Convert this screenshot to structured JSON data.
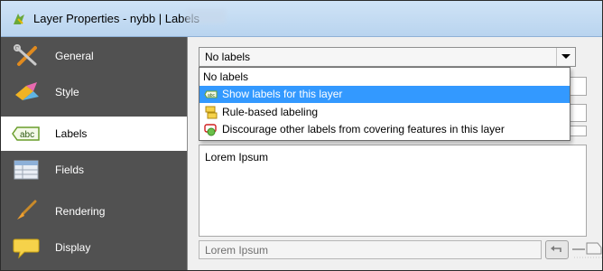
{
  "window": {
    "title": "Layer Properties - nybb | Labels"
  },
  "sidebar": {
    "items": [
      {
        "label": "General",
        "icon": "tools-icon"
      },
      {
        "label": "Style",
        "icon": "paint-icon"
      },
      {
        "label": "Labels",
        "icon": "abc-label-icon",
        "active": true
      },
      {
        "label": "Fields",
        "icon": "table-icon"
      },
      {
        "label": "Rendering",
        "icon": "brush-icon"
      },
      {
        "label": "Display",
        "icon": "speech-bubble-icon"
      }
    ]
  },
  "labeling": {
    "mode_selected": "No labels",
    "options": [
      {
        "label": "No labels",
        "icon": ""
      },
      {
        "label": "Show labels for this layer",
        "icon": "abc-label-icon",
        "highlighted": true
      },
      {
        "label": "Rule-based labeling",
        "icon": "rule-labels-icon"
      },
      {
        "label": "Discourage other labels from covering features in this layer",
        "icon": "blocking-icon"
      }
    ]
  },
  "preview": {
    "text": "Lorem Ipsum"
  },
  "sample_input": {
    "placeholder": "Lorem Ipsum"
  },
  "colors": {
    "sidebar_bg": "#515151",
    "highlight": "#3399ff",
    "titlebar": "#c4dbf2"
  }
}
